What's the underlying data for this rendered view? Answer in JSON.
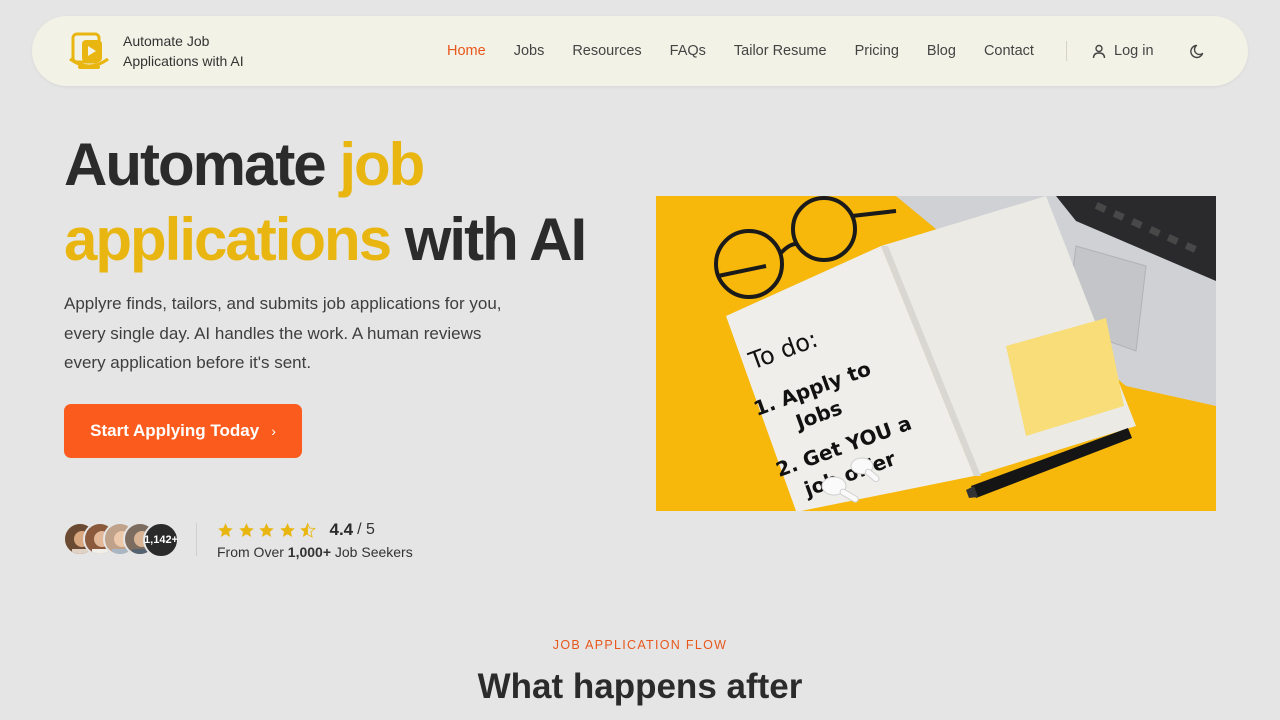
{
  "brand": {
    "name": "Automate Job Applications with AI"
  },
  "nav": {
    "links": [
      "Home",
      "Jobs",
      "Resources",
      "FAQs",
      "Tailor Resume",
      "Pricing",
      "Blog",
      "Contact"
    ],
    "active": "Home",
    "login": "Log in"
  },
  "hero": {
    "title_part1": "Automate ",
    "title_highlight": "job applications",
    "title_part2": " with AI",
    "subtitle": "Applyre finds, tailors, and submits job applications for you, every single day. AI handles the work. A human reviews every application before it's sent.",
    "cta": "Start Applying Today",
    "avatar_count": "1,142+",
    "rating": "4.4",
    "rating_max": "/ 5",
    "rating_stars": 4.5,
    "caption_prefix": "From Over ",
    "caption_bold": "1,000+",
    "caption_suffix": " Job Seekers",
    "image_note_title": "To do:",
    "image_note_line1": "1. Apply to",
    "image_note_line2": "Jobs",
    "image_note_line3": "2. Get YOU a",
    "image_note_line4": "job offer"
  },
  "flow": {
    "eyebrow": "JOB APPLICATION FLOW",
    "title": "What happens after"
  },
  "colors": {
    "accent": "#fb5c1d",
    "highlight": "#e9b611",
    "nav_bg": "#f3f2e6",
    "page_bg": "#e5e5e5"
  },
  "icons": {
    "logo": "document-arrow-logo",
    "login": "user-icon",
    "theme": "moon-icon",
    "cta": "chevron-right-icon",
    "star": "star-icon"
  }
}
